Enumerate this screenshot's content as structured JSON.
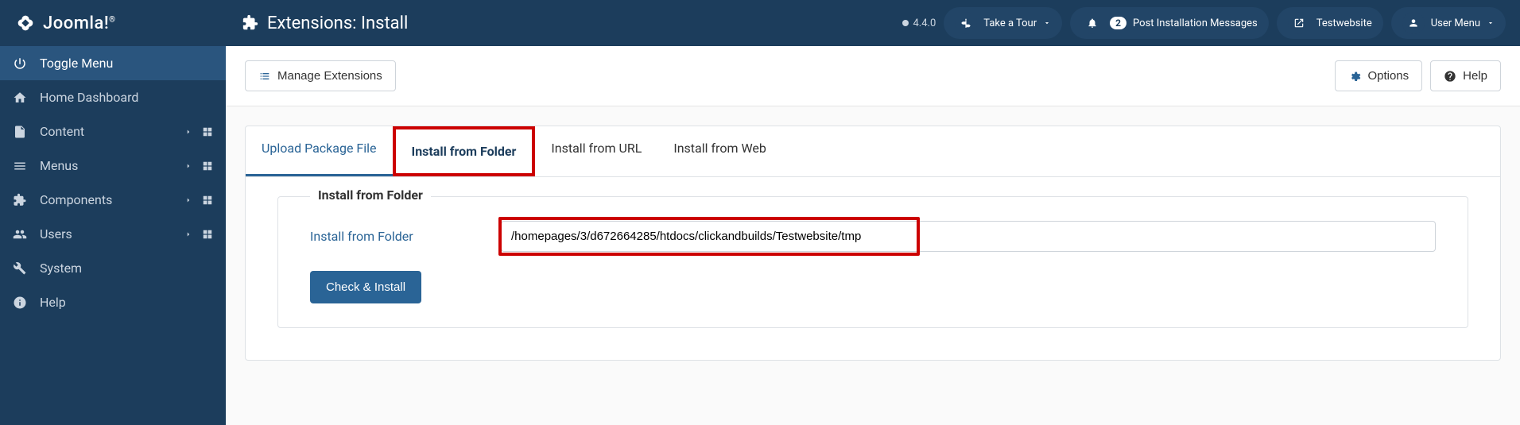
{
  "brand": "Joomla!",
  "page": {
    "title": "Extensions: Install"
  },
  "header": {
    "version": "4.4.0",
    "tour": "Take a Tour",
    "notifications": {
      "count": "2",
      "label": "Post Installation Messages"
    },
    "site": "Testwebsite",
    "usermenu": "User Menu"
  },
  "sidebar": {
    "toggle": "Toggle Menu",
    "items": [
      {
        "label": "Home Dashboard",
        "icon": "home"
      },
      {
        "label": "Content",
        "icon": "file",
        "expandable": true
      },
      {
        "label": "Menus",
        "icon": "bars",
        "expandable": true
      },
      {
        "label": "Components",
        "icon": "puzzle",
        "expandable": true
      },
      {
        "label": "Users",
        "icon": "users",
        "expandable": true
      },
      {
        "label": "System",
        "icon": "wrench"
      },
      {
        "label": "Help",
        "icon": "info"
      }
    ]
  },
  "toolbar": {
    "manage": "Manage Extensions",
    "options": "Options",
    "help": "Help"
  },
  "tabs": [
    "Upload Package File",
    "Install from Folder",
    "Install from URL",
    "Install from Web"
  ],
  "form": {
    "legend": "Install from Folder",
    "label": "Install from Folder",
    "value": "/homepages/3/d672664285/htdocs/clickandbuilds/Testwebsite/tmp",
    "submit": "Check & Install"
  }
}
